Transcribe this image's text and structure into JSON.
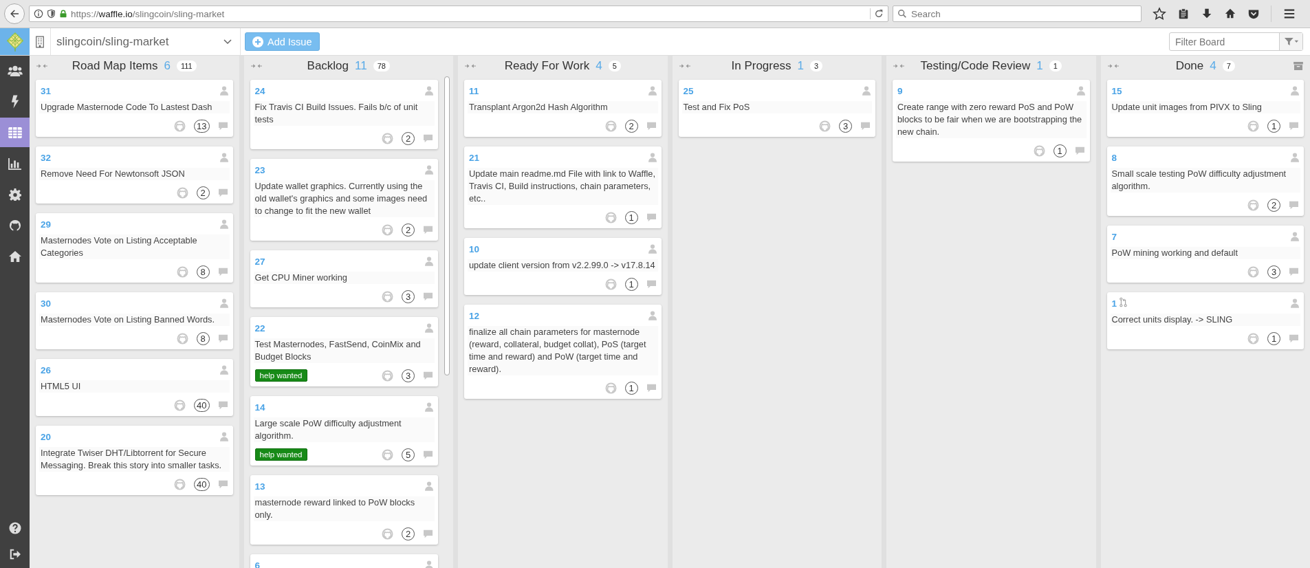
{
  "browser": {
    "url_scheme": "https://",
    "url_domain": "waffle.io",
    "url_path": "/slingcoin/sling-market",
    "search_placeholder": "Search"
  },
  "app": {
    "repo": "slingcoin/sling-market",
    "add_button": "Add Issue",
    "filter_placeholder": "Filter Board"
  },
  "sidebar": {
    "items": [
      {
        "kind": "users",
        "selected": false
      },
      {
        "kind": "lightning",
        "selected": false
      },
      {
        "kind": "grid",
        "selected": true
      },
      {
        "kind": "chart",
        "selected": false
      },
      {
        "kind": "settings",
        "selected": false
      },
      {
        "kind": "cat",
        "selected": false
      },
      {
        "kind": "home",
        "selected": false
      }
    ],
    "bottom_items": [
      {
        "kind": "help"
      },
      {
        "kind": "logout"
      }
    ]
  },
  "columns": [
    {
      "title": "Road Map Items",
      "count": "6",
      "total": "111",
      "archive_button": false,
      "scrollable": false,
      "cards": [
        {
          "number": "31",
          "title": "Upgrade Masternode Code To Lastest Dash",
          "points": "13",
          "pull_request": false
        },
        {
          "number": "32",
          "title": "Remove Need For Newtonsoft JSON",
          "points": "2",
          "pull_request": false
        },
        {
          "number": "29",
          "title": "Masternodes Vote on Listing Acceptable Categories",
          "points": "8",
          "pull_request": false
        },
        {
          "number": "30",
          "title": "Masternodes Vote on Listing Banned Words.",
          "points": "8",
          "pull_request": false
        },
        {
          "number": "26",
          "title": "HTML5 UI",
          "points": "40",
          "pull_request": false
        },
        {
          "number": "20",
          "title": "Integrate Twiser DHT/Libtorrent for Secure Messaging. Break this story into smaller tasks.",
          "points": "40",
          "pull_request": false
        }
      ]
    },
    {
      "title": "Backlog",
      "count": "11",
      "total": "78",
      "archive_button": false,
      "scrollable": true,
      "cards": [
        {
          "number": "24",
          "title": "Fix Travis CI Build Issues. Fails b/c of unit tests",
          "points": "2",
          "pull_request": false
        },
        {
          "number": "23",
          "title": "Update wallet graphics. Currently using the old wallet's graphics and some images need to change to fit the new wallet",
          "points": "2",
          "pull_request": false
        },
        {
          "number": "27",
          "title": "Get CPU Miner working",
          "points": "3",
          "pull_request": false
        },
        {
          "number": "22",
          "title": "Test Masternodes, FastSend, CoinMix and Budget Blocks",
          "labels": [
            "help wanted"
          ],
          "points": "3",
          "pull_request": false
        },
        {
          "number": "14",
          "title": "Large scale PoW difficulty adjustment algorithm.",
          "labels": [
            "help wanted"
          ],
          "points": "5",
          "pull_request": false
        },
        {
          "number": "13",
          "title": "masternode reward linked to PoW blocks only.",
          "points": "2",
          "pull_request": false
        },
        {
          "number": "6",
          "pull_request": false
        }
      ]
    },
    {
      "title": "Ready For Work",
      "count": "4",
      "total": "5",
      "archive_button": false,
      "scrollable": false,
      "cards": [
        {
          "number": "11",
          "title": "Transplant Argon2d Hash Algorithm",
          "points": "2",
          "pull_request": false
        },
        {
          "number": "21",
          "title": "Update main readme.md File with link to Waffle, Travis CI, Build instructions, chain parameters, etc..",
          "points": "1",
          "pull_request": false
        },
        {
          "number": "10",
          "title": "update client version from v2.2.99.0 -> v17.8.14",
          "points": "1",
          "pull_request": false
        },
        {
          "number": "12",
          "title": "finalize all chain parameters for masternode (reward, collateral, budget collat), PoS (target time and reward) and PoW (target time and reward).",
          "points": "1",
          "pull_request": false
        }
      ]
    },
    {
      "title": "In Progress",
      "count": "1",
      "total": "3",
      "archive_button": false,
      "scrollable": false,
      "cards": [
        {
          "number": "25",
          "title": "Test and Fix PoS",
          "points": "3",
          "pull_request": false
        }
      ]
    },
    {
      "title": "Testing/Code Review",
      "count": "1",
      "total": "1",
      "archive_button": false,
      "scrollable": false,
      "cards": [
        {
          "number": "9",
          "title": "Create range with zero reward PoS and PoW blocks to be fair when we are bootstrapping the new chain.",
          "points": "1",
          "pull_request": false
        }
      ]
    },
    {
      "title": "Done",
      "count": "4",
      "total": "7",
      "archive_button": true,
      "scrollable": false,
      "cards": [
        {
          "number": "15",
          "title": "Update unit images from PIVX to Sling",
          "points": "1",
          "pull_request": false
        },
        {
          "number": "8",
          "title": "Small scale testing PoW difficulty adjustment algorithm.",
          "points": "2",
          "pull_request": false
        },
        {
          "number": "7",
          "title": "PoW mining working and default",
          "points": "3",
          "pull_request": false
        },
        {
          "number": "1",
          "title": "Correct units display. -> SLING",
          "points": "1",
          "pull_request": true
        }
      ]
    }
  ]
}
